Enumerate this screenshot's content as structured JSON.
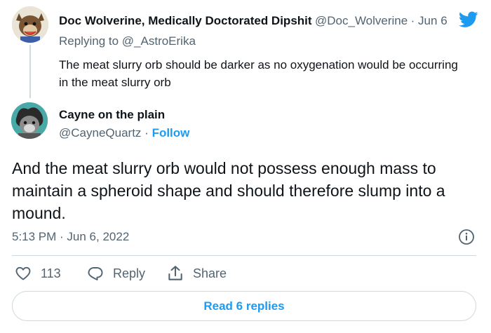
{
  "parent_tweet": {
    "author_name": "Doc Wolverine, Medically Doctorated Dipshit",
    "author_handle": "@Doc_Wolverine",
    "partial_time": "· Jun 6",
    "replying_label": "Replying to",
    "replying_handle": "@_AstroErika",
    "text": "The meat slurry orb should be darker as no oxygenation would be occurring in the meat slurry orb"
  },
  "main_tweet": {
    "author_name": "Cayne on the plain",
    "author_handle": "@CayneQuartz",
    "separator": "·",
    "follow_label": "Follow",
    "text": "And the meat slurry orb would not possess enough mass to maintain a spheroid shape and should therefore slump into a mound.",
    "timestamp": "5:13 PM · Jun 6, 2022"
  },
  "actions": {
    "like_count": "113",
    "reply_label": "Reply",
    "share_label": "Share"
  },
  "read_replies_label": "Read 6 replies",
  "colors": {
    "accent": "#1d9bf0",
    "muted": "#536471",
    "border": "#cfd9de"
  }
}
